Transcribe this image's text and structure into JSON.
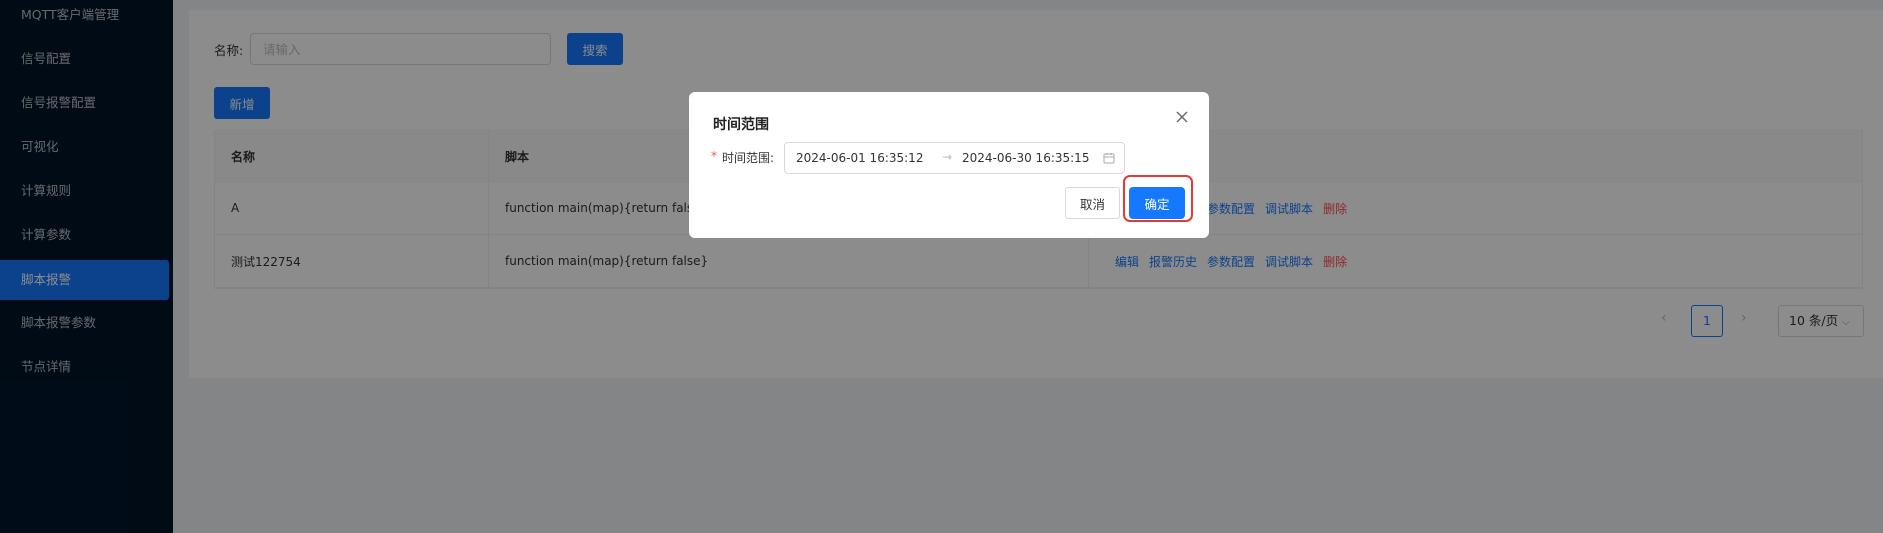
{
  "sidebar": {
    "items": [
      {
        "label": "MQTT客户端管理"
      },
      {
        "label": "信号配置"
      },
      {
        "label": "信号报警配置"
      },
      {
        "label": "可视化"
      },
      {
        "label": "计算规则"
      },
      {
        "label": "计算参数"
      },
      {
        "label": "脚本报警",
        "active": true
      },
      {
        "label": "脚本报警参数"
      },
      {
        "label": "节点详情"
      }
    ]
  },
  "search": {
    "label": "名称:",
    "placeholder": "请输入",
    "button_label": "搜索"
  },
  "toolbar": {
    "add_label": "新增"
  },
  "table": {
    "columns": [
      "名称",
      "脚本",
      ""
    ],
    "rows": [
      {
        "name": "A",
        "script": "function main(map){return false}"
      },
      {
        "name": "测试122754",
        "script": "function main(map){return false}"
      }
    ],
    "actions": {
      "edit": "编辑",
      "history": "报警历史",
      "params": "参数配置",
      "debug": "调试脚本",
      "delete": "删除"
    }
  },
  "pagination": {
    "prev_icon": "‹",
    "current_page": "1",
    "next_icon": "›",
    "page_size": "10 条/页"
  },
  "modal": {
    "title": "时间范围",
    "field_label": "时间范围:",
    "required_mark": "*",
    "start": "2024-06-01 16:35:12",
    "separator": "→",
    "end": "2024-06-30 16:35:15",
    "cancel_label": "取消",
    "ok_label": "确定",
    "close_icon": "close-icon"
  },
  "colors": {
    "primary": "#1677ff",
    "danger": "#ff4d4f",
    "sidebar_bg": "#001529",
    "highlight": "#e53935"
  }
}
